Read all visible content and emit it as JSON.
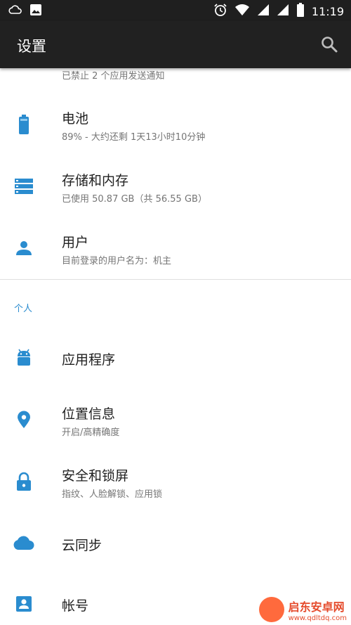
{
  "status_bar": {
    "time": "11:19",
    "icons": [
      "weather-icon",
      "image-icon",
      "alarm-icon",
      "wifi-icon",
      "signal-icon",
      "signal-2-icon",
      "battery-icon"
    ]
  },
  "toolbar": {
    "title": "设置",
    "search_icon": "search-icon"
  },
  "items": [
    {
      "icon": "notification-icon",
      "title": "",
      "subtitle": "已禁止 2 个应用发送通知"
    },
    {
      "icon": "battery-icon",
      "title": "电池",
      "subtitle": "89% - 大约还剩 1天13小时10分钟"
    },
    {
      "icon": "storage-icon",
      "title": "存储和内存",
      "subtitle": "已使用 50.87 GB（共 56.55 GB）"
    },
    {
      "icon": "user-icon",
      "title": "用户",
      "subtitle": "目前登录的用户名为：机主"
    }
  ],
  "section_personal": {
    "header": "个人",
    "items": [
      {
        "icon": "android-icon",
        "title": "应用程序",
        "subtitle": ""
      },
      {
        "icon": "location-icon",
        "title": "位置信息",
        "subtitle": "开启/高精确度"
      },
      {
        "icon": "lock-icon",
        "title": "安全和锁屏",
        "subtitle": "指纹、人脸解锁、应用锁"
      },
      {
        "icon": "cloud-icon",
        "title": "云同步",
        "subtitle": ""
      },
      {
        "icon": "account-icon",
        "title": "帐号",
        "subtitle": ""
      }
    ]
  },
  "watermark": {
    "title": "启东安卓网",
    "url": "www.qdltdq.com"
  },
  "colors": {
    "accent": "#2a8ccf",
    "toolbar": "#212121",
    "statusbar": "#1f1f1f"
  }
}
